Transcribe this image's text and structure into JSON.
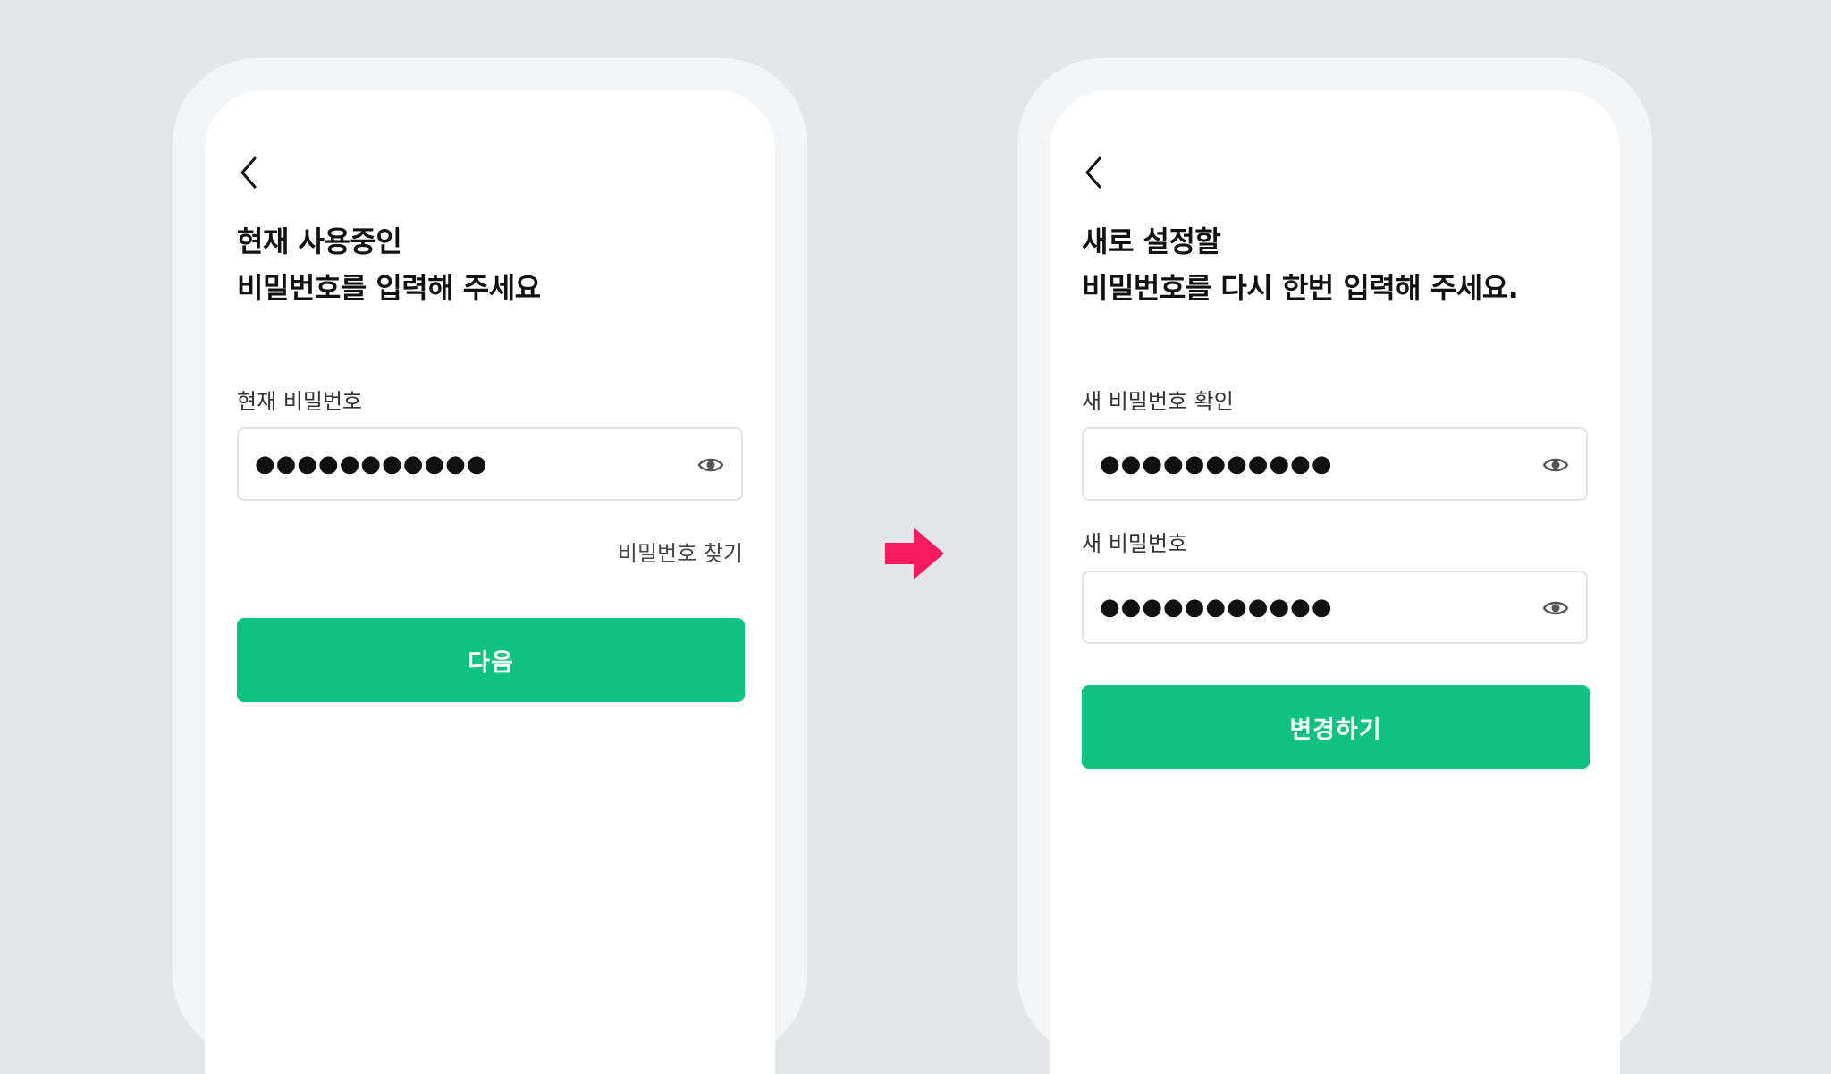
{
  "colors": {
    "background": "#e3e6ea",
    "phone_frame": "#f4f5f7",
    "screen": "#ffffff",
    "primary": "#0fc27f",
    "flow_arrow": "#f5195e",
    "icon": "#555555"
  },
  "screen_current": {
    "back_icon": "chevron-left-icon",
    "heading_line1": "현재 사용중인",
    "heading_line2": "비밀번호를 입력해 주세요",
    "field_label": "현재 비밀번호",
    "field_value": "●●●●●●●●●●●",
    "eye_icon": "eye-icon",
    "find_password_link": "비밀번호 찾기",
    "next_button": "다음"
  },
  "flow_arrow_icon": "right-arrow-icon",
  "screen_new": {
    "back_icon": "chevron-left-icon",
    "heading_line1": "새로 설정할",
    "heading_line2": "비밀번호를 다시 한번 입력해 주세요.",
    "confirm_label": "새 비밀번호 확인",
    "confirm_value": "●●●●●●●●●●●",
    "new_label": "새 비밀번호",
    "new_value": "●●●●●●●●●●●",
    "eye_icon": "eye-icon",
    "change_button": "변경하기"
  }
}
